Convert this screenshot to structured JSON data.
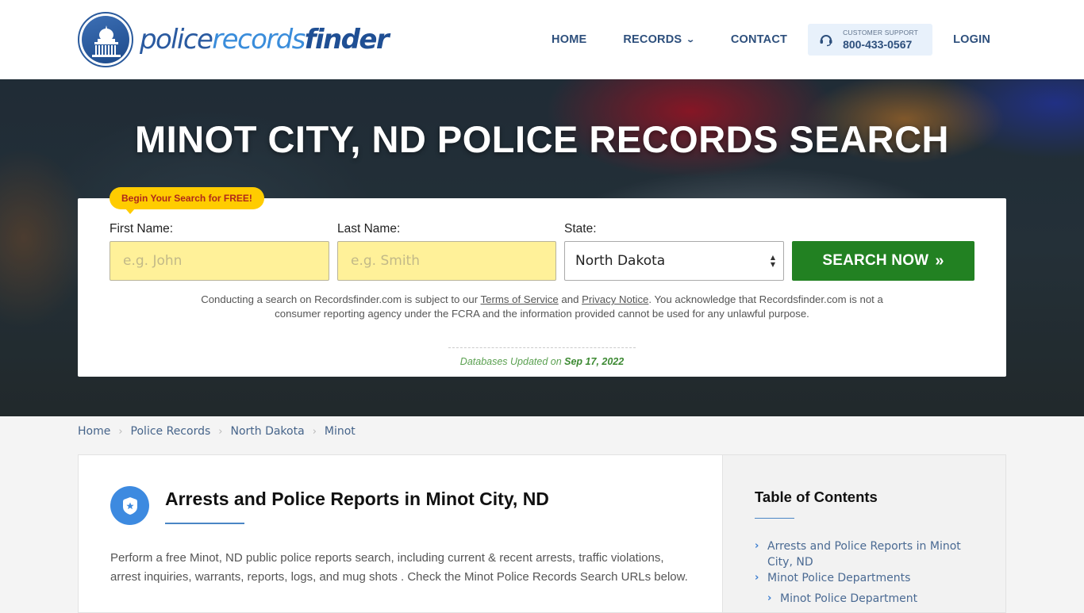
{
  "header": {
    "logo": {
      "part1": "police",
      "part2": "records",
      "part3": "finder"
    },
    "nav": [
      {
        "label": "HOME"
      },
      {
        "label": "RECORDS",
        "has_dropdown": true
      },
      {
        "label": "CONTACT"
      }
    ],
    "support": {
      "label": "CUSTOMER SUPPORT",
      "phone": "800-433-0567"
    },
    "login_label": "LOGIN"
  },
  "hero": {
    "title": "MINOT CITY, ND POLICE RECORDS SEARCH",
    "badge": "Begin Your Search for FREE!",
    "form": {
      "first_name_label": "First Name:",
      "first_name_placeholder": "e.g. John",
      "first_name_value": "",
      "last_name_label": "Last Name:",
      "last_name_placeholder": "e.g. Smith",
      "last_name_value": "",
      "state_label": "State:",
      "state_value": "North Dakota",
      "search_button": "SEARCH NOW",
      "search_button_icon": "double-chevron-right"
    },
    "disclaimer": {
      "part1": "Conducting a search on Recordsfinder.com is subject to our ",
      "terms_link": "Terms of Service",
      "part2": " and ",
      "privacy_link": "Privacy Notice",
      "part3": ". You acknowledge that Recordsfinder.com is not a consumer reporting agency under the FCRA and the information provided cannot be used for any unlawful purpose."
    },
    "db_updated_label": "Databases Updated on ",
    "db_updated_date": "Sep 17, 2022"
  },
  "breadcrumb": [
    {
      "label": "Home"
    },
    {
      "label": "Police Records"
    },
    {
      "label": "North Dakota"
    },
    {
      "label": "Minot"
    }
  ],
  "main": {
    "section_icon": "police-badge-icon",
    "title": "Arrests and Police Reports in Minot City, ND",
    "intro": "Perform a free Minot, ND public police reports search, including current & recent arrests, traffic violations, arrest inquiries, warrants, reports, logs, and mug shots . Check the Minot Police Records Search URLs below."
  },
  "sidebar": {
    "toc_title": "Table of Contents",
    "items": [
      {
        "label": "Arrests and Police Reports in Minot City, ND",
        "level": 1
      },
      {
        "label": "Minot Police Departments",
        "level": 1
      },
      {
        "label": "Minot Police Department",
        "level": 2
      }
    ]
  },
  "colors": {
    "brand_blue": "#2a5aa0",
    "nav_text": "#2d4f7c",
    "search_green": "#228122",
    "input_yellow": "#fff199",
    "badge_yellow": "#ffcc00",
    "accent_blue": "#3d8ae0"
  }
}
